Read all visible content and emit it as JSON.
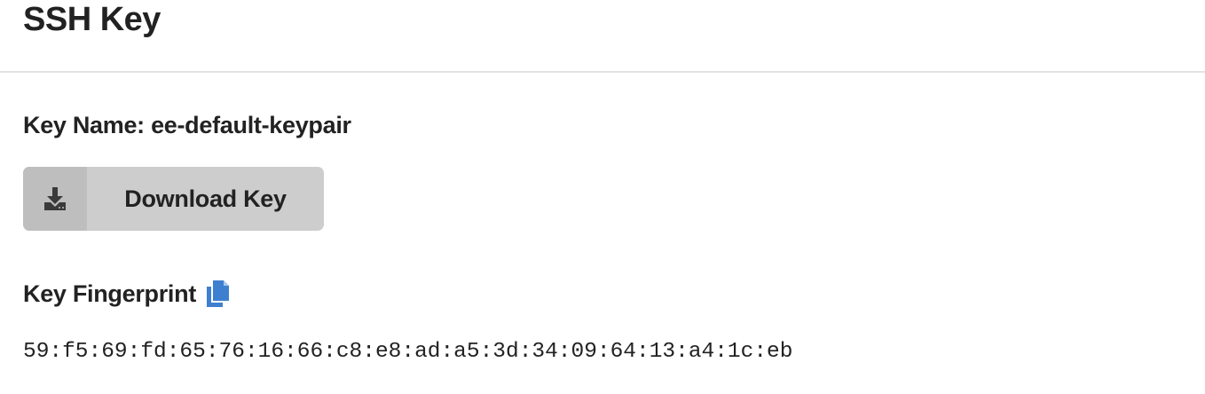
{
  "header": {
    "title": "SSH Key"
  },
  "key": {
    "name_label": "Key Name: ee-default-keypair"
  },
  "download": {
    "label": "Download Key",
    "icon": "download-icon"
  },
  "fingerprint": {
    "heading": "Key Fingerprint",
    "copy_icon": "copy-icon",
    "value": "59:f5:69:fd:65:76:16:66:c8:e8:ad:a5:3d:34:09:64:13:a4:1c:eb"
  },
  "colors": {
    "button_bg": "#cdcdcd",
    "button_icon_bg": "#bebebe",
    "accent_blue": "#3f7fd0",
    "text": "#222222"
  }
}
